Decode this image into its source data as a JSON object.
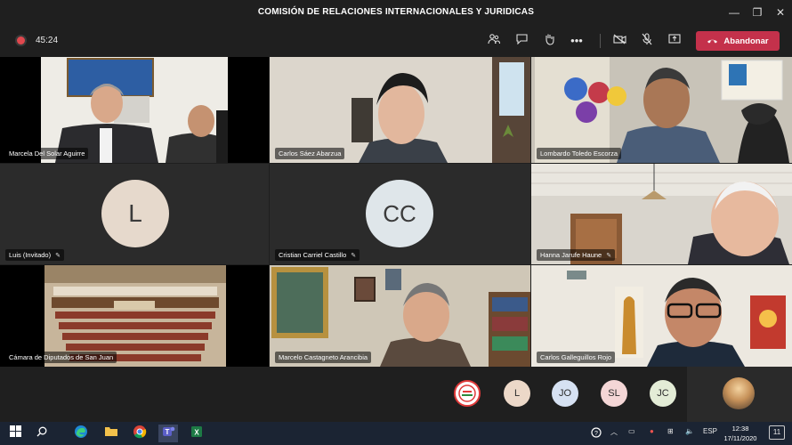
{
  "window": {
    "title": "COMISIÓN DE RELACIONES INTERNACIONALES Y JURIDICAS"
  },
  "meeting": {
    "timer": "45:24",
    "leave_label": "Abandonar"
  },
  "participants": [
    {
      "name": "Marcela Del Solar Aguirre"
    },
    {
      "name": "Carlos Sáez Abarzua"
    },
    {
      "name": "Lombardo Toledo Escorza"
    },
    {
      "name": "Luis (Invitado)",
      "initials": "L"
    },
    {
      "name": "Cristian Carriel Castillo",
      "initials": "CC"
    },
    {
      "name": "Hanna Jarufe Haune"
    },
    {
      "name": "Cámara de Diputados de San Juan"
    },
    {
      "name": "Marcelo Castagneto Arancibia"
    },
    {
      "name": "Carlos Galleguillos Rojo"
    }
  ],
  "overflow": [
    {
      "initials": "",
      "color": "#ffffff"
    },
    {
      "initials": "L",
      "color": "#ecd8c8"
    },
    {
      "initials": "JO",
      "color": "#d6e1f2"
    },
    {
      "initials": "SL",
      "color": "#f4d6d6"
    },
    {
      "initials": "JC",
      "color": "#e3ecd6"
    }
  ],
  "taskbar": {
    "lang": "ESP",
    "time": "12:38",
    "date": "17/11/2020",
    "notif": "11"
  }
}
